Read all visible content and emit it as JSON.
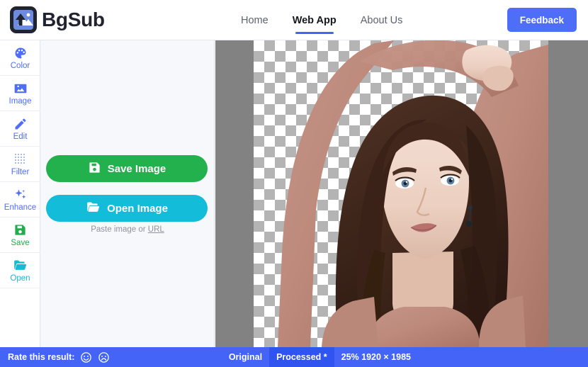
{
  "header": {
    "brand_name": "BgSub",
    "logo_icon": "image-upload-icon",
    "nav": [
      {
        "label": "Home",
        "active": false
      },
      {
        "label": "Web App",
        "active": true
      },
      {
        "label": "About Us",
        "active": false
      }
    ],
    "feedback_label": "Feedback",
    "accent_color": "#4f6ef7"
  },
  "sidebar": {
    "items": [
      {
        "label": "Color",
        "icon": "palette-icon",
        "color": "#4f6ef7"
      },
      {
        "label": "Image",
        "icon": "photo-icon",
        "color": "#4f6ef7"
      },
      {
        "label": "Edit",
        "icon": "pencil-icon",
        "color": "#4f6ef7"
      },
      {
        "label": "Filter",
        "icon": "dot-grid-icon",
        "color": "#4f6ef7"
      },
      {
        "label": "Enhance",
        "icon": "sparkles-icon",
        "color": "#4f6ef7"
      },
      {
        "label": "Save",
        "icon": "floppy-icon",
        "color": "#22ac4b"
      },
      {
        "label": "Open",
        "icon": "folder-icon",
        "color": "#18b9d4"
      }
    ]
  },
  "panel": {
    "save_button": {
      "label": "Save Image",
      "icon": "floppy-icon",
      "color": "#22b14c"
    },
    "open_button": {
      "label": "Open Image",
      "icon": "folder-icon",
      "color": "#13bcd9"
    },
    "paste_hint_prefix": "Paste image or ",
    "paste_hint_link": "URL"
  },
  "canvas": {
    "background_color": "#828282",
    "transparency_checker": true,
    "image_description": "Portrait of a woman with long brown hair in a dusty-rose knit sweater, arms raised above her head, background removed"
  },
  "statusbar": {
    "rate_label": "Rate this result:",
    "happy_icon": "smiley-face-icon",
    "sad_icon": "frowny-face-icon",
    "tabs": [
      {
        "label": "Original",
        "active": false
      },
      {
        "label": "Processed *",
        "active": true
      }
    ],
    "zoom_and_size": "25% 1920 × 1985",
    "background_color": "#4364f7",
    "active_tab_color": "#2f54f0"
  }
}
